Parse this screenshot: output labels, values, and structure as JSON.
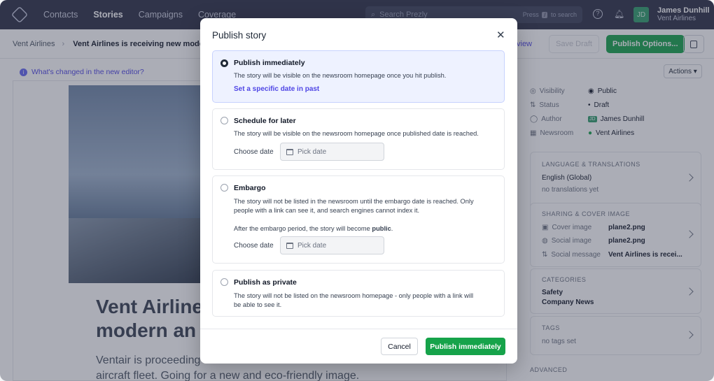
{
  "nav": {
    "items": [
      "Contacts",
      "Stories",
      "Campaigns",
      "Coverage"
    ],
    "search_placeholder": "Search Prezly",
    "search_hint_pre": "Press",
    "search_hint_key": "/",
    "search_hint_post": "to search",
    "user_initials": "JD",
    "user_name": "James Dunhill",
    "user_org": "Vent Airlines"
  },
  "subbar": {
    "crumb": "Vent Airlines",
    "story_title": "Vent Airlines is receiving new modern",
    "preview": "view",
    "save_draft": "Save Draft",
    "publish_options": "Publish Options..."
  },
  "info": {
    "whats_changed": "What's changed in the new editor?",
    "actions": "Actions"
  },
  "story": {
    "headline_1": "Vent Airline",
    "headline_2": "modern an",
    "body_1": "Ventair is proceeding",
    "body_2": "aircraft fleet. Going for a new and eco-friendly image."
  },
  "sidebar": {
    "visibility_label": "Visibility",
    "visibility_value": "Public",
    "status_label": "Status",
    "status_value": "Draft",
    "author_label": "Author",
    "author_value": "James Dunhill",
    "author_initials": "JD",
    "newsroom_label": "Newsroom",
    "newsroom_value": "Vent Airlines",
    "lang_heading": "Language & Translations",
    "lang_value": "English (Global)",
    "lang_sub": "no translations yet",
    "sharing_heading": "Sharing & Cover Image",
    "cover_label": "Cover image",
    "cover_value": "plane2.png",
    "social_label": "Social image",
    "social_value": "plane2.png",
    "msg_label": "Social message",
    "msg_value": "Vent Airlines is recei...",
    "cat_heading": "Categories",
    "cat_1": "Safety",
    "cat_2": "Company News",
    "tags_heading": "Tags",
    "tags_value": "no tags set",
    "advanced": "Advanced"
  },
  "modal": {
    "title": "Publish story",
    "opt1_title": "Publish immediately",
    "opt1_desc": "The story will be visible on the newsroom homepage once you hit publish.",
    "opt1_link": "Set a specific date in past",
    "opt2_title": "Schedule for later",
    "opt2_desc": "The story will be visible on the newsroom homepage once published date is reached.",
    "opt3_title": "Embargo",
    "opt3_desc_1": "The story will not be listed in the newsroom until the embargo date is reached. Only",
    "opt3_desc_2": "people with a link can see it, and search engines cannot index it.",
    "opt3_after_pre": "After the embargo period, the story will become",
    "opt3_after_bold": "public",
    "opt3_after_post": ".",
    "opt4_title": "Publish as private",
    "opt4_desc_1": "The story will not be listed on the newsroom homepage - only people with a link will",
    "opt4_desc_2": "be able to see it.",
    "choose_date": "Choose date",
    "pick_date": "Pick date",
    "cancel": "Cancel",
    "publish": "Publish immediately"
  },
  "colors": {
    "nav_bg": "#2b2f45",
    "accent": "#4f46e5",
    "publish_green": "#16a34a",
    "selected_bg": "#eef2ff"
  }
}
